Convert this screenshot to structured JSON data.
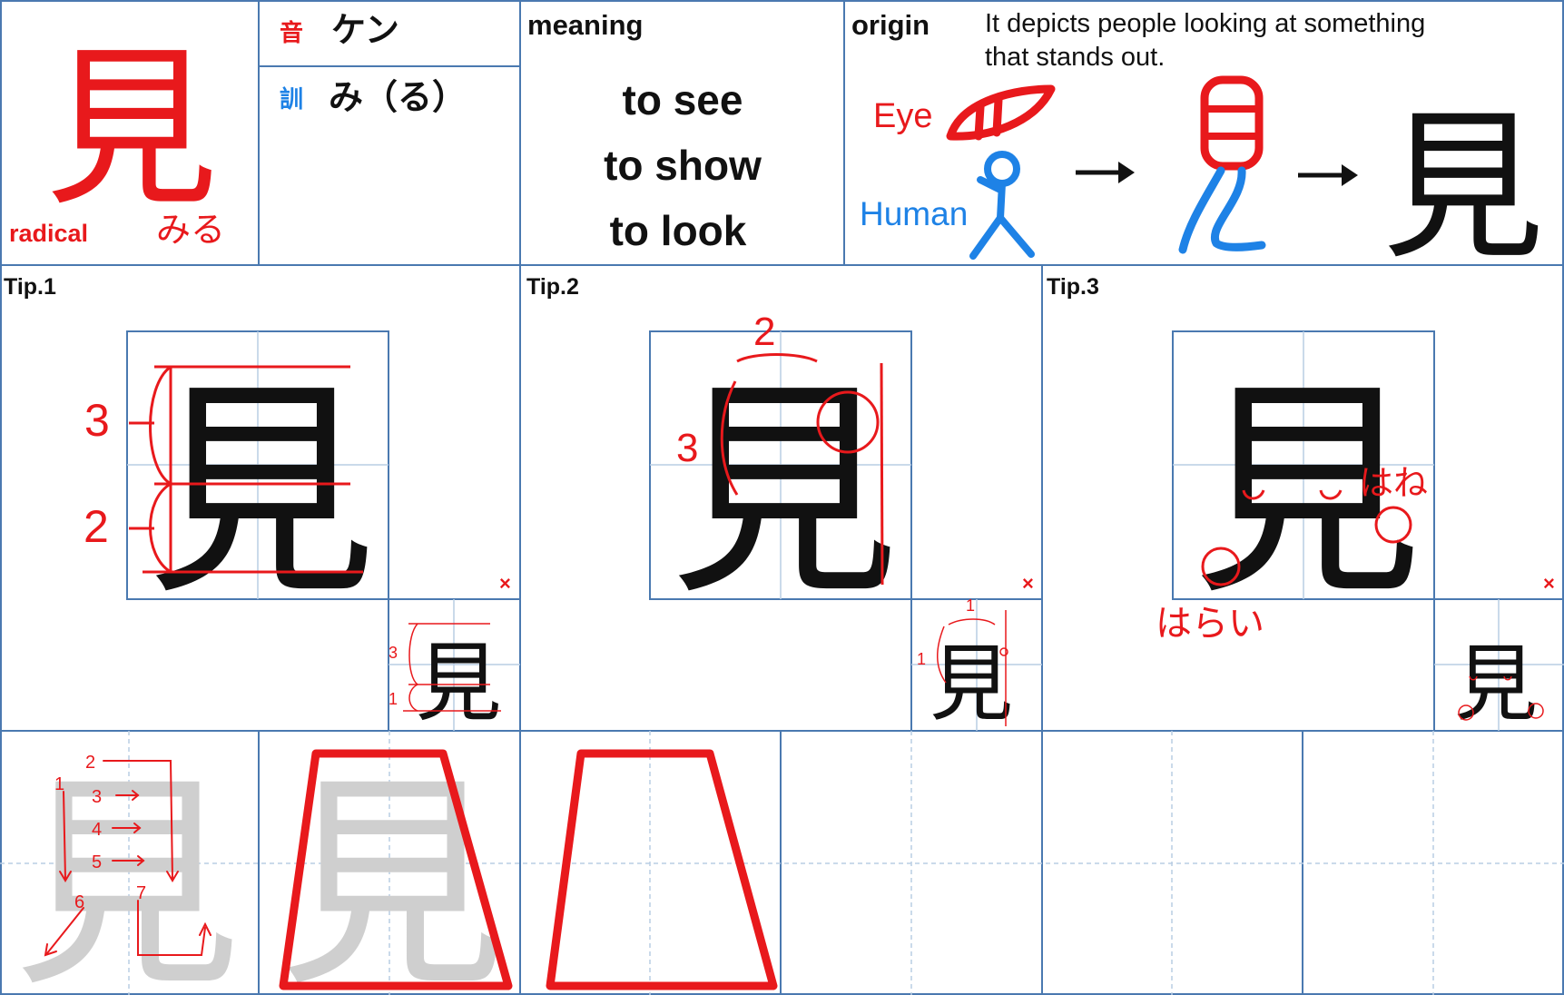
{
  "header": {
    "kanji": "見",
    "radical_label": "radical",
    "radical_reading": "みる",
    "on_badge": "音",
    "on_reading": "ケン",
    "kun_badge": "訓",
    "kun_reading": "み（る）",
    "meaning_title": "meaning",
    "meanings": [
      "to see",
      "to show",
      "to look"
    ],
    "origin_title": "origin",
    "origin_text_line1": "It depicts people looking at something",
    "origin_text_line2": "that stands out.",
    "eye_label": "Eye",
    "human_label": "Human"
  },
  "tips": [
    {
      "title": "Tip.1",
      "labels": [
        "3",
        "2"
      ],
      "small_labels": [
        "3",
        "1"
      ]
    },
    {
      "title": "Tip.2",
      "labels": [
        "2",
        "3"
      ],
      "small_labels": [
        "1",
        "1"
      ]
    },
    {
      "title": "Tip.3",
      "labels": [
        "はね",
        "はらい"
      ]
    }
  ],
  "tip_mark": "×",
  "stroke_numbers": [
    "1",
    "2",
    "3",
    "4",
    "5",
    "6",
    "7"
  ],
  "colors": {
    "grid_blue": "#4a79b0",
    "guide_blue": "#b9cde4",
    "accent_red": "#e8191c",
    "human_blue": "#1e82e6",
    "stroke_gray": "#cfcfcf"
  }
}
